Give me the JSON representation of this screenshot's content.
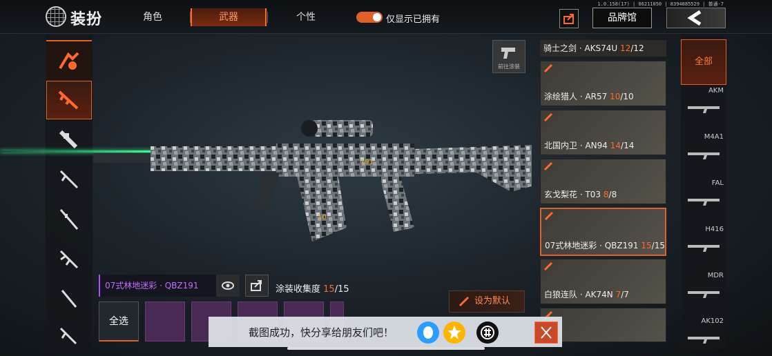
{
  "version_text": "1.0.158(17) | 06211050 | 8394885529 | 普通-7",
  "header": {
    "title": "装扮",
    "tabs": [
      {
        "label": "角色",
        "active": false
      },
      {
        "label": "武器",
        "active": true
      },
      {
        "label": "个性",
        "active": false
      }
    ],
    "toggle_label": "仅显示已拥有",
    "toggle_on": true,
    "brand_button": "品牌馆"
  },
  "left_categories": [
    {
      "icon": "emblem-icon"
    },
    {
      "icon": "assault-rifle-icon",
      "active": true
    },
    {
      "icon": "smg-icon"
    },
    {
      "icon": "shotgun-icon"
    },
    {
      "icon": "sniper-rifle-icon"
    },
    {
      "icon": "lmg-icon"
    },
    {
      "icon": "marksman-rifle-icon"
    },
    {
      "icon": "pistol-icon"
    }
  ],
  "skin_button_label": "前往涂装",
  "skins_list": [
    {
      "name": "骑士之剑 · AKS74U",
      "owned": "12",
      "total": "12"
    },
    {
      "name": "涂绘猎人 · AR57",
      "owned": "10",
      "total": "10"
    },
    {
      "name": "北国内卫 · AN94",
      "owned": "14",
      "total": "14"
    },
    {
      "name": "玄戈梨花 · T03",
      "owned": "8",
      "total": "8"
    },
    {
      "name": "07式林地迷彩 · QBZ191",
      "owned": "15",
      "total": "15",
      "selected": true
    },
    {
      "name": "白狼连队 · AK74N",
      "owned": "7",
      "total": "7"
    }
  ],
  "right_weapons": {
    "all_label": "全部",
    "items": [
      "AKM",
      "M4A1",
      "FAL",
      "H416",
      "MDR",
      "AK102"
    ]
  },
  "bottom": {
    "current_skin": "07式林地迷彩 · QBZ191",
    "more": "•••",
    "collection_label": "涂装收集度",
    "collection_owned": "15",
    "collection_total": "/15",
    "select_all": "全选",
    "set_default": "设为默认"
  },
  "toast": {
    "text": "截图成功，快分享给朋友们吧！"
  },
  "colors": {
    "accent": "#e0602a",
    "purple": "#c46cff",
    "laser": "#3cff9a"
  }
}
